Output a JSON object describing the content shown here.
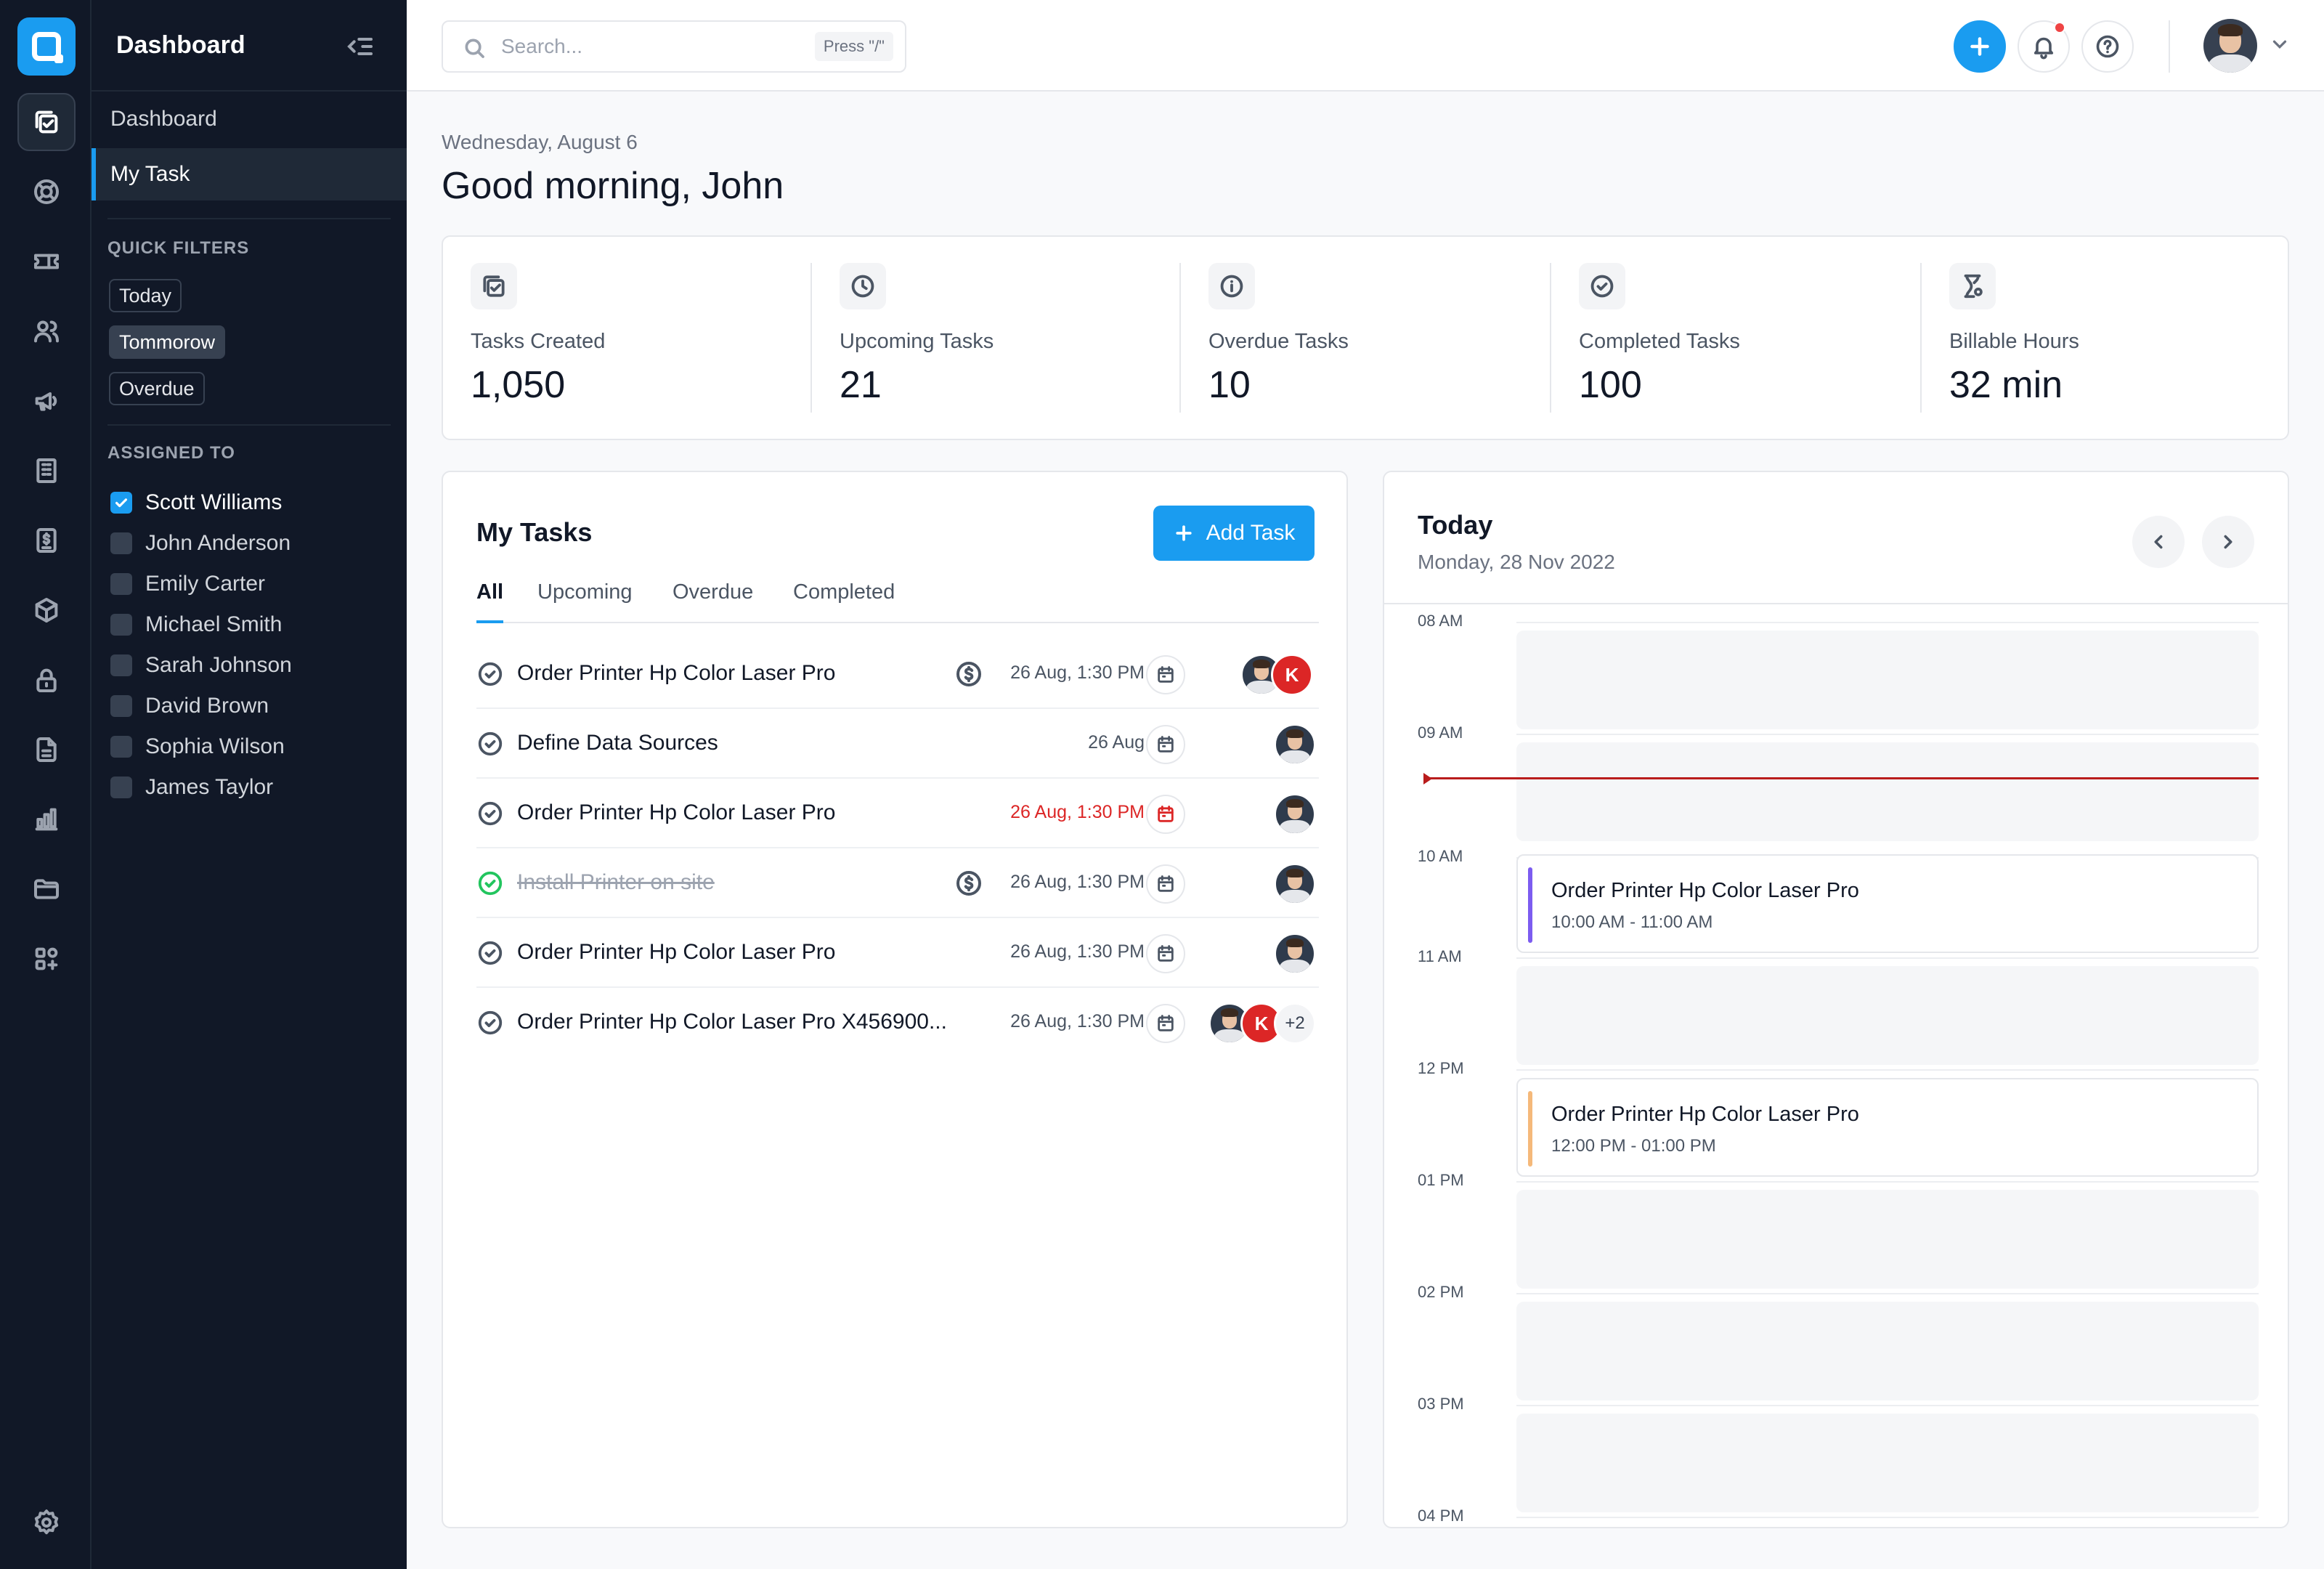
{
  "sidebar": {
    "title": "Dashboard",
    "nav": [
      {
        "label": "Dashboard"
      },
      {
        "label": "My Task"
      }
    ],
    "quick_filters_heading": "QUICK FILTERS",
    "quick_filters": [
      "Today",
      "Tommorow",
      "Overdue"
    ],
    "assigned_heading": "ASSIGNED TO",
    "assignees": [
      {
        "name": "Scott Williams",
        "checked": true
      },
      {
        "name": "John Anderson",
        "checked": false
      },
      {
        "name": "Emily Carter",
        "checked": false
      },
      {
        "name": "Michael Smith",
        "checked": false
      },
      {
        "name": "Sarah Johnson",
        "checked": false
      },
      {
        "name": "David Brown",
        "checked": false
      },
      {
        "name": "Sophia Wilson",
        "checked": false
      },
      {
        "name": "James Taylor",
        "checked": false
      }
    ]
  },
  "rail_icons": [
    "tasks-icon",
    "support-icon",
    "ticket-icon",
    "users-icon",
    "megaphone-icon",
    "building-icon",
    "invoice-icon",
    "box-icon",
    "lock-icon",
    "document-icon",
    "chart-icon",
    "folder-icon",
    "apps-icon",
    "settings-icon"
  ],
  "topbar": {
    "search_placeholder": "Search...",
    "search_shortcut": "Press \"/\""
  },
  "main": {
    "date": "Wednesday, August 6",
    "greeting": "Good morning, John"
  },
  "stats": [
    {
      "label": "Tasks Created",
      "value": "1,050",
      "icon": "tasks-icon"
    },
    {
      "label": "Upcoming Tasks",
      "value": "21",
      "icon": "clock-icon"
    },
    {
      "label": "Overdue Tasks",
      "value": "10",
      "icon": "info-icon"
    },
    {
      "label": "Completed Tasks",
      "value": "100",
      "icon": "check-circle-icon"
    },
    {
      "label": "Billable Hours",
      "value": "32 min",
      "icon": "hourglass-icon"
    }
  ],
  "tasks": {
    "title": "My Tasks",
    "add_label": "Add Task",
    "tabs": [
      "All",
      "Upcoming",
      "Overdue",
      "Completed"
    ],
    "active_tab": "All",
    "rows": [
      {
        "name": "Order Printer Hp Color Laser Pro",
        "due": "26 Aug, 1:30 PM",
        "billable": true,
        "late": false,
        "done": false
      },
      {
        "name": "Define Data Sources",
        "due": "26 Aug",
        "billable": false,
        "late": false,
        "done": false
      },
      {
        "name": "Order Printer Hp Color Laser Pro",
        "due": "26 Aug, 1:30 PM",
        "billable": false,
        "late": true,
        "done": false
      },
      {
        "name": "Install Printer on site",
        "due": "26 Aug, 1:30 PM",
        "billable": true,
        "late": false,
        "done": true
      },
      {
        "name": "Order Printer Hp Color Laser Pro",
        "due": "26 Aug, 1:30 PM",
        "billable": false,
        "late": false,
        "done": false
      },
      {
        "name": "Order Printer Hp Color Laser Pro X456900...",
        "due": "26 Aug, 1:30 PM",
        "billable": false,
        "late": false,
        "done": false
      }
    ],
    "avatar_initial": "K",
    "more_count": "+2"
  },
  "calendar": {
    "title": "Today",
    "date": "Monday, 28 Nov 2022",
    "hours": [
      "08 AM",
      "09 AM",
      "10 AM",
      "11 AM",
      "12 PM",
      "01 PM",
      "02 PM",
      "03 PM",
      "04 PM"
    ],
    "events": [
      {
        "title": "Order Printer Hp Color Laser Pro",
        "time": "10:00 AM - 11:00 AM",
        "color": "#7c5cf0"
      },
      {
        "title": "Order Printer Hp Color Laser Pro",
        "time": "12:00 PM - 01:00 PM",
        "color": "#f5b97a"
      }
    ]
  },
  "colors": {
    "accent": "#1a9cf0",
    "sidebar_bg": "#111827",
    "danger": "#dc2626",
    "success": "#22c55e"
  }
}
